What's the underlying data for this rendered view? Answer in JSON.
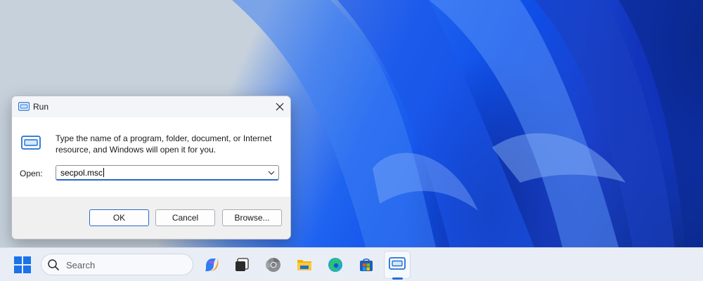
{
  "dialog": {
    "title": "Run",
    "description": "Type the name of a program, folder, document, or Internet resource, and Windows will open it for you.",
    "open_label": "Open:",
    "open_value": "secpol.msc",
    "buttons": {
      "ok": "OK",
      "cancel": "Cancel",
      "browse": "Browse..."
    }
  },
  "taskbar": {
    "search_placeholder": "Search",
    "icons": [
      "windows-start-icon",
      "copilot-icon",
      "task-view-icon",
      "chrome-icon",
      "file-explorer-icon",
      "edge-icon",
      "microsoft-store-icon",
      "run-app-icon"
    ]
  },
  "colors": {
    "accent": "#2b67c6",
    "taskbar_bg": "#e9eef6",
    "dialog_footer": "#f0f0f0"
  }
}
